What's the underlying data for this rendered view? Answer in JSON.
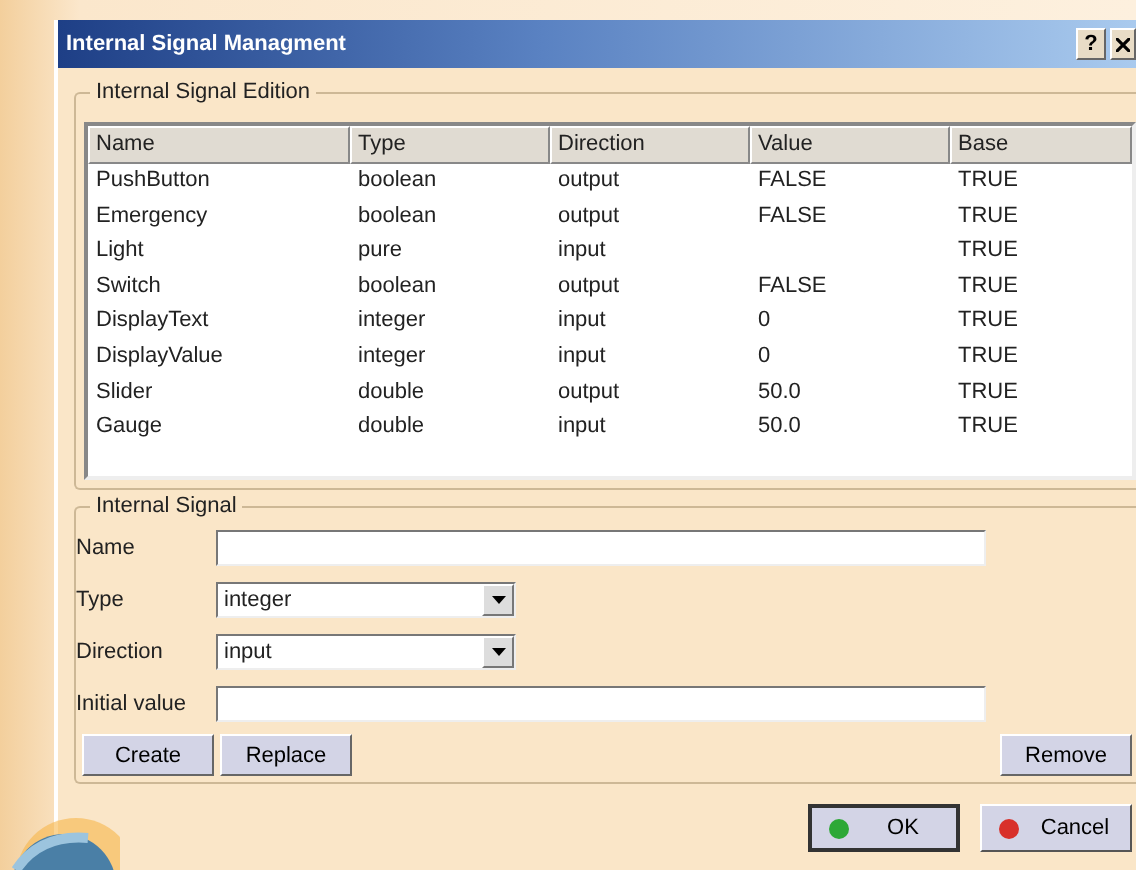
{
  "window": {
    "title": "Internal Signal Managment",
    "help": "?"
  },
  "edition_group": {
    "title": "Internal Signal Edition",
    "table": {
      "columns": [
        "Name",
        "Type",
        "Direction",
        "Value",
        "Base"
      ],
      "rows": [
        [
          "PushButton",
          "boolean",
          "output",
          "FALSE",
          "TRUE"
        ],
        [
          "Emergency",
          "boolean",
          "output",
          "FALSE",
          "TRUE"
        ],
        [
          "Light",
          "pure",
          "input",
          "",
          "TRUE"
        ],
        [
          "Switch",
          "boolean",
          "output",
          "FALSE",
          "TRUE"
        ],
        [
          "DisplayText",
          "integer",
          "input",
          "0",
          "TRUE"
        ],
        [
          "DisplayValue",
          "integer",
          "input",
          "0",
          "TRUE"
        ],
        [
          "Slider",
          "double",
          "output",
          "50.0",
          "TRUE"
        ],
        [
          "Gauge",
          "double",
          "input",
          "50.0",
          "TRUE"
        ]
      ]
    }
  },
  "signal_group": {
    "title": "Internal Signal",
    "fields": [
      {
        "kind": "text",
        "label": "Name"
      },
      {
        "kind": "combo",
        "label": "Type",
        "value": "integer"
      },
      {
        "kind": "combo",
        "label": "Direction",
        "value": "input"
      },
      {
        "kind": "text",
        "label": "Initial value"
      }
    ],
    "buttons": [
      "Create",
      "Replace"
    ],
    "remove_button": "Remove"
  },
  "dialog_buttons": [
    {
      "kind": "ok",
      "label": "OK"
    },
    {
      "kind": "cancel",
      "label": "Cancel"
    }
  ]
}
